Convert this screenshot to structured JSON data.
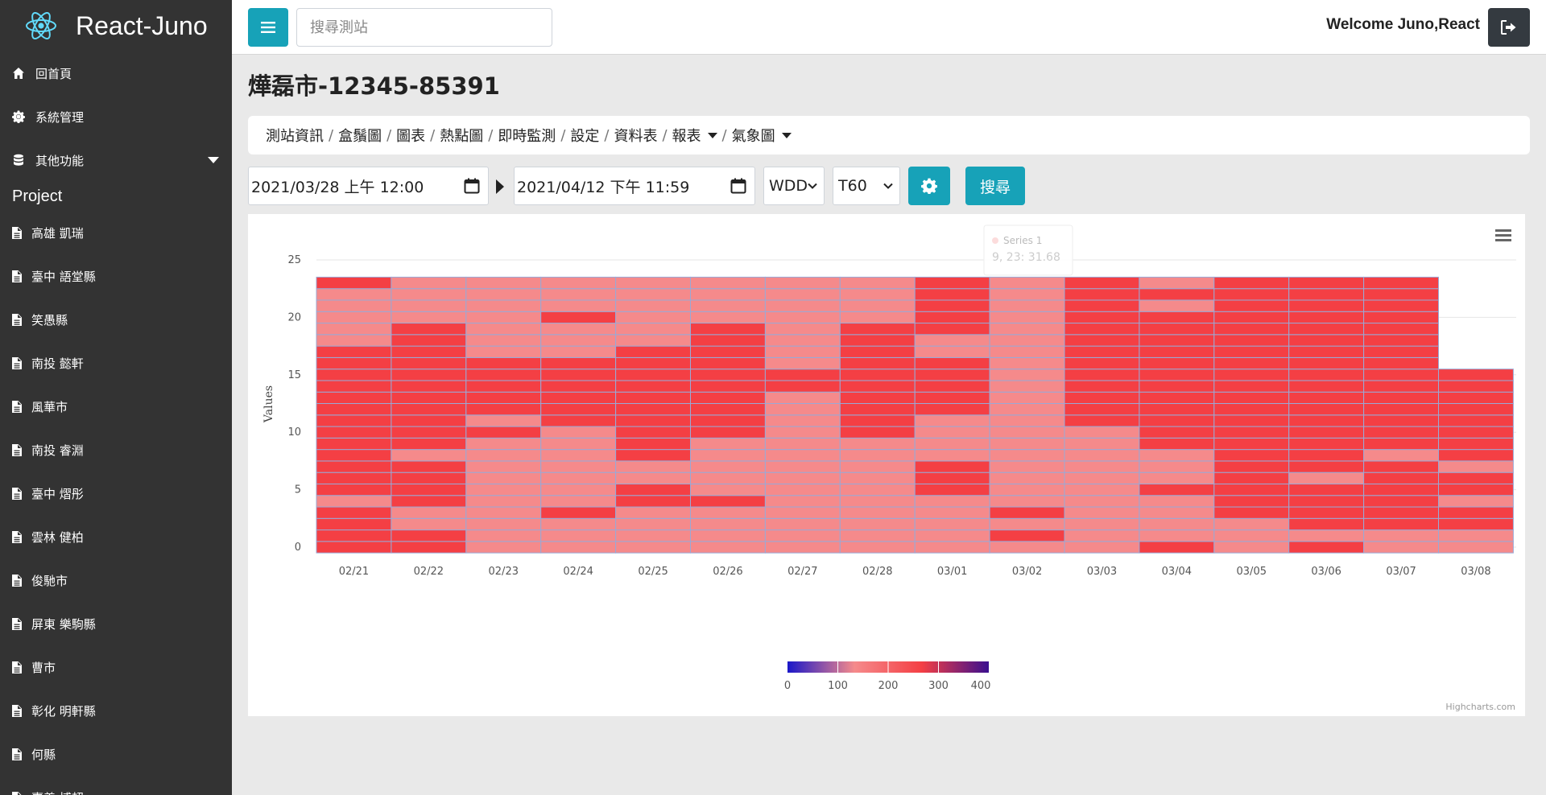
{
  "app": {
    "name": "React-Juno"
  },
  "sidebar": {
    "menu": [
      {
        "label": "回首頁",
        "icon": "home-icon"
      },
      {
        "label": "系統管理",
        "icon": "gear-icon"
      },
      {
        "label": "其他功能",
        "icon": "database-icon"
      }
    ],
    "project_title": "Project",
    "projects": [
      "高雄 凱瑞",
      "臺中 語堂縣",
      "笑愚縣",
      "南投 懿軒",
      "風華市",
      "南投 睿淵",
      "臺中 熠彤",
      "雲林 健柏",
      "俊馳市",
      "屏東 樂駒縣",
      "曹市",
      "彰化 明軒縣",
      "何縣",
      "嘉義 博超"
    ]
  },
  "topbar": {
    "search_placeholder": "搜尋測站",
    "welcome": "Welcome Juno,React"
  },
  "page": {
    "title": "燁磊市-12345-85391",
    "breadcrumbs": [
      "測站資訊",
      "盒鬚圖",
      "圖表",
      "熱點圖",
      "即時監測",
      "設定",
      "資料表",
      "報表",
      "氣象圖"
    ]
  },
  "controls": {
    "start_date": "2021/03/28 上午 12:00",
    "end_date": "2021/04/12 下午 11:59",
    "select1": "WDD",
    "select2": "T60",
    "search_label": "搜尋"
  },
  "chart_data": {
    "type": "heatmap",
    "ylabel": "Values",
    "x_categories": [
      "02/21",
      "02/22",
      "02/23",
      "02/24",
      "02/25",
      "02/26",
      "02/27",
      "02/28",
      "03/01",
      "03/02",
      "03/03",
      "03/04",
      "03/05",
      "03/06",
      "03/07",
      "03/08"
    ],
    "y_ticks": [
      0,
      5,
      10,
      15,
      20,
      25
    ],
    "y_range": [
      0,
      25
    ],
    "rows_per_day": [
      24,
      24,
      24,
      24,
      24,
      24,
      24,
      24,
      24,
      24,
      24,
      24,
      24,
      24,
      24,
      16
    ],
    "hot_hours": [
      [
        0,
        1,
        2,
        3,
        5,
        6,
        7,
        8,
        9,
        10,
        11,
        12,
        13,
        14,
        15,
        16,
        17,
        23
      ],
      [
        0,
        1,
        4,
        5,
        6,
        7,
        9,
        10,
        11,
        12,
        13,
        14,
        15,
        16,
        17,
        18,
        19
      ],
      [
        10,
        12,
        13,
        14,
        15,
        16
      ],
      [
        3,
        11,
        12,
        13,
        14,
        15,
        16,
        20
      ],
      [
        4,
        5,
        8,
        9,
        10,
        11,
        12,
        13,
        14,
        15,
        16,
        17
      ],
      [
        4,
        10,
        11,
        12,
        13,
        14,
        15,
        16,
        17,
        18,
        19
      ],
      [
        14,
        15
      ],
      [
        10,
        11,
        12,
        13,
        14,
        15,
        16,
        17,
        18,
        19
      ],
      [
        5,
        6,
        7,
        12,
        13,
        14,
        15,
        16,
        19,
        20,
        21,
        22,
        23
      ],
      [
        1,
        3
      ],
      [
        11,
        12,
        13,
        14,
        15,
        16,
        17,
        18,
        19,
        20,
        21,
        22,
        23
      ],
      [
        0,
        5,
        9,
        10,
        11,
        12,
        13,
        14,
        15,
        16,
        17,
        18,
        19,
        20,
        22
      ],
      [
        3,
        4,
        5,
        6,
        7,
        8,
        9,
        10,
        11,
        12,
        13,
        14,
        15,
        16,
        17,
        18,
        19,
        20,
        21,
        22,
        23
      ],
      [
        0,
        2,
        3,
        4,
        5,
        7,
        8,
        9,
        10,
        11,
        12,
        13,
        14,
        15,
        16,
        17,
        18,
        19,
        20,
        21,
        22,
        23
      ],
      [
        2,
        3,
        4,
        5,
        6,
        7,
        9,
        10,
        11,
        12,
        13,
        14,
        15,
        16,
        17,
        18,
        19,
        20,
        21,
        22,
        23
      ],
      [
        2,
        3,
        5,
        6,
        8,
        9,
        10,
        11,
        12,
        13,
        14,
        15
      ]
    ],
    "colors": {
      "hot": "#f43f44",
      "warm": "#f58a8b"
    },
    "color_axis": {
      "stops": [
        "#1a17c9",
        "#f58a8b",
        "#f43f44",
        "#3a0f8f"
      ],
      "labels": [
        0,
        100,
        200,
        300,
        400
      ]
    },
    "tooltip": {
      "series": "Series 1",
      "value": "9, 23: 31.68"
    },
    "credits": "Highcharts.com"
  }
}
